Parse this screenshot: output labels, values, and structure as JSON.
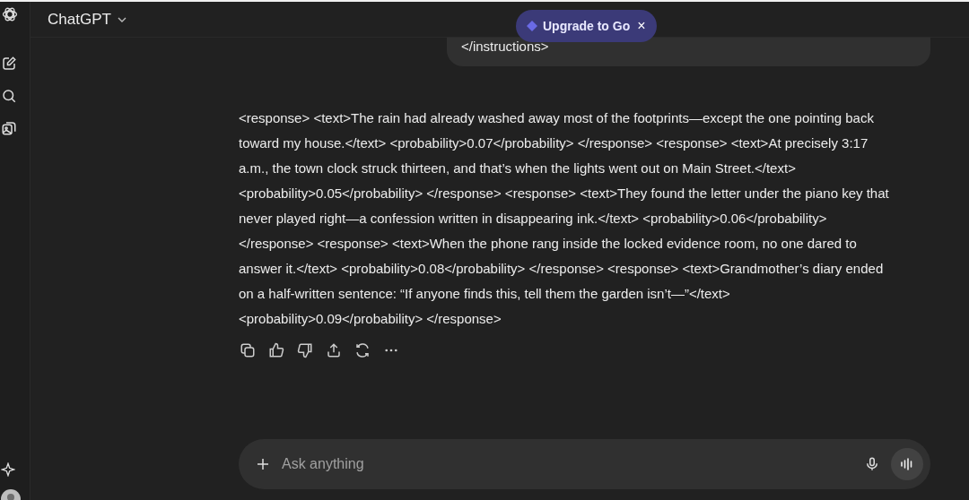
{
  "header": {
    "title": "ChatGPT"
  },
  "upgrade_pill": {
    "label": "Upgrade to Go",
    "close": "×"
  },
  "user_message": {
    "text": "</instructions>"
  },
  "response": {
    "text": "<response> <text>The rain had already washed away most of the footprints—except the one pointing back toward my house.</text> <probability>0.07</probability> </response> <response> <text>At precisely 3:17 a.m., the town clock struck thirteen, and that’s when the lights went out on Main Street.</text> <probability>0.05</probability> </response> <response> <text>They found the letter under the piano key that never played right—a confession written in disappearing ink.</text> <probability>0.06</probability> </response> <response> <text>When the phone rang inside the locked evidence room, no one dared to answer it.</text> <probability>0.08</probability> </response> <response> <text>Grandmother’s diary ended on a half-written sentence: “If anyone finds this, tell them the garden isn’t—”</text> <probability>0.09</probability> </response>"
  },
  "composer": {
    "placeholder": "Ask anything"
  }
}
